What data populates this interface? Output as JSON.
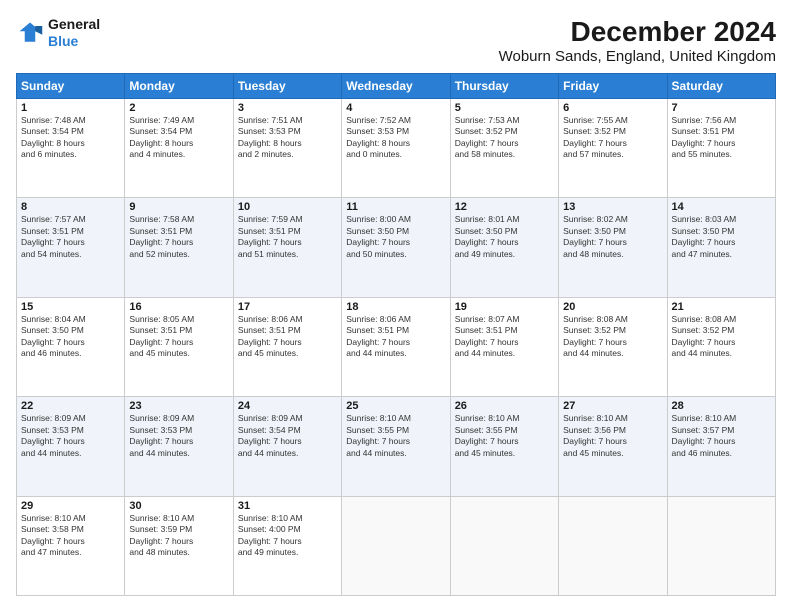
{
  "header": {
    "logo_line1": "General",
    "logo_line2": "Blue",
    "title": "December 2024",
    "subtitle": "Woburn Sands, England, United Kingdom"
  },
  "calendar": {
    "days_of_week": [
      "Sunday",
      "Monday",
      "Tuesday",
      "Wednesday",
      "Thursday",
      "Friday",
      "Saturday"
    ],
    "weeks": [
      [
        {
          "num": "1",
          "info": "Sunrise: 7:48 AM\nSunset: 3:54 PM\nDaylight: 8 hours\nand 6 minutes."
        },
        {
          "num": "2",
          "info": "Sunrise: 7:49 AM\nSunset: 3:54 PM\nDaylight: 8 hours\nand 4 minutes."
        },
        {
          "num": "3",
          "info": "Sunrise: 7:51 AM\nSunset: 3:53 PM\nDaylight: 8 hours\nand 2 minutes."
        },
        {
          "num": "4",
          "info": "Sunrise: 7:52 AM\nSunset: 3:53 PM\nDaylight: 8 hours\nand 0 minutes."
        },
        {
          "num": "5",
          "info": "Sunrise: 7:53 AM\nSunset: 3:52 PM\nDaylight: 7 hours\nand 58 minutes."
        },
        {
          "num": "6",
          "info": "Sunrise: 7:55 AM\nSunset: 3:52 PM\nDaylight: 7 hours\nand 57 minutes."
        },
        {
          "num": "7",
          "info": "Sunrise: 7:56 AM\nSunset: 3:51 PM\nDaylight: 7 hours\nand 55 minutes."
        }
      ],
      [
        {
          "num": "8",
          "info": "Sunrise: 7:57 AM\nSunset: 3:51 PM\nDaylight: 7 hours\nand 54 minutes."
        },
        {
          "num": "9",
          "info": "Sunrise: 7:58 AM\nSunset: 3:51 PM\nDaylight: 7 hours\nand 52 minutes."
        },
        {
          "num": "10",
          "info": "Sunrise: 7:59 AM\nSunset: 3:51 PM\nDaylight: 7 hours\nand 51 minutes."
        },
        {
          "num": "11",
          "info": "Sunrise: 8:00 AM\nSunset: 3:50 PM\nDaylight: 7 hours\nand 50 minutes."
        },
        {
          "num": "12",
          "info": "Sunrise: 8:01 AM\nSunset: 3:50 PM\nDaylight: 7 hours\nand 49 minutes."
        },
        {
          "num": "13",
          "info": "Sunrise: 8:02 AM\nSunset: 3:50 PM\nDaylight: 7 hours\nand 48 minutes."
        },
        {
          "num": "14",
          "info": "Sunrise: 8:03 AM\nSunset: 3:50 PM\nDaylight: 7 hours\nand 47 minutes."
        }
      ],
      [
        {
          "num": "15",
          "info": "Sunrise: 8:04 AM\nSunset: 3:50 PM\nDaylight: 7 hours\nand 46 minutes."
        },
        {
          "num": "16",
          "info": "Sunrise: 8:05 AM\nSunset: 3:51 PM\nDaylight: 7 hours\nand 45 minutes."
        },
        {
          "num": "17",
          "info": "Sunrise: 8:06 AM\nSunset: 3:51 PM\nDaylight: 7 hours\nand 45 minutes."
        },
        {
          "num": "18",
          "info": "Sunrise: 8:06 AM\nSunset: 3:51 PM\nDaylight: 7 hours\nand 44 minutes."
        },
        {
          "num": "19",
          "info": "Sunrise: 8:07 AM\nSunset: 3:51 PM\nDaylight: 7 hours\nand 44 minutes."
        },
        {
          "num": "20",
          "info": "Sunrise: 8:08 AM\nSunset: 3:52 PM\nDaylight: 7 hours\nand 44 minutes."
        },
        {
          "num": "21",
          "info": "Sunrise: 8:08 AM\nSunset: 3:52 PM\nDaylight: 7 hours\nand 44 minutes."
        }
      ],
      [
        {
          "num": "22",
          "info": "Sunrise: 8:09 AM\nSunset: 3:53 PM\nDaylight: 7 hours\nand 44 minutes."
        },
        {
          "num": "23",
          "info": "Sunrise: 8:09 AM\nSunset: 3:53 PM\nDaylight: 7 hours\nand 44 minutes."
        },
        {
          "num": "24",
          "info": "Sunrise: 8:09 AM\nSunset: 3:54 PM\nDaylight: 7 hours\nand 44 minutes."
        },
        {
          "num": "25",
          "info": "Sunrise: 8:10 AM\nSunset: 3:55 PM\nDaylight: 7 hours\nand 44 minutes."
        },
        {
          "num": "26",
          "info": "Sunrise: 8:10 AM\nSunset: 3:55 PM\nDaylight: 7 hours\nand 45 minutes."
        },
        {
          "num": "27",
          "info": "Sunrise: 8:10 AM\nSunset: 3:56 PM\nDaylight: 7 hours\nand 45 minutes."
        },
        {
          "num": "28",
          "info": "Sunrise: 8:10 AM\nSunset: 3:57 PM\nDaylight: 7 hours\nand 46 minutes."
        }
      ],
      [
        {
          "num": "29",
          "info": "Sunrise: 8:10 AM\nSunset: 3:58 PM\nDaylight: 7 hours\nand 47 minutes."
        },
        {
          "num": "30",
          "info": "Sunrise: 8:10 AM\nSunset: 3:59 PM\nDaylight: 7 hours\nand 48 minutes."
        },
        {
          "num": "31",
          "info": "Sunrise: 8:10 AM\nSunset: 4:00 PM\nDaylight: 7 hours\nand 49 minutes."
        },
        {
          "num": "",
          "info": ""
        },
        {
          "num": "",
          "info": ""
        },
        {
          "num": "",
          "info": ""
        },
        {
          "num": "",
          "info": ""
        }
      ]
    ]
  }
}
